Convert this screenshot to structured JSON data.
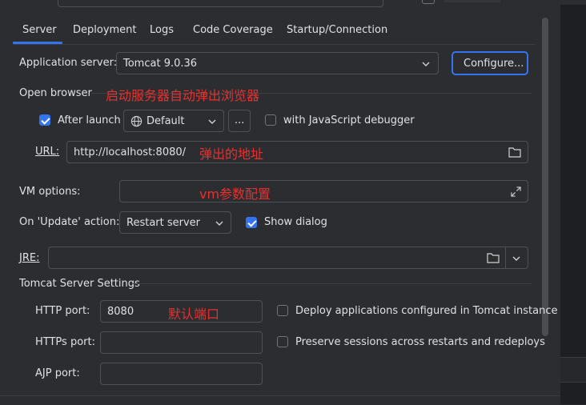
{
  "tabs": [
    {
      "label": "Server"
    },
    {
      "label": "Deployment"
    },
    {
      "label": "Logs"
    },
    {
      "label": "Code Coverage"
    },
    {
      "label": "Startup/Connection"
    }
  ],
  "server": {
    "app_server_label": "Application server:",
    "app_server_value": "Tomcat 9.0.36",
    "configure_label": "Configure..."
  },
  "open_browser": {
    "section_label": "Open browser",
    "annotation": "启动服务器自动弹出浏览器",
    "after_launch_label": "After launch",
    "after_launch_checked": true,
    "browser_value": "Default",
    "more_label": "...",
    "js_debugger_label": "with JavaScript debugger",
    "js_debugger_checked": false,
    "url_label": "URL:",
    "url_value": "http://localhost:8080/",
    "url_annotation": "弹出的地址"
  },
  "vm": {
    "label": "VM options:",
    "annotation": "vm参数配置"
  },
  "update": {
    "label": "On 'Update' action:",
    "value": "Restart server",
    "show_dialog_label": "Show dialog",
    "show_dialog_checked": true
  },
  "jre": {
    "label": "JRE:"
  },
  "tomcat": {
    "section_label": "Tomcat Server Settings",
    "http_port_label": "HTTP port:",
    "http_port_value": "8080",
    "http_annotation": "默认端口",
    "https_port_label": "HTTPs port:",
    "ajp_port_label": "AJP port:",
    "deploy_label": "Deploy applications configured in Tomcat instance",
    "preserve_label": "Preserve sessions across restarts and redeploys"
  },
  "colors": {
    "accent": "#3574f0",
    "annotation": "#e5312f",
    "background": "#2b2d30"
  }
}
